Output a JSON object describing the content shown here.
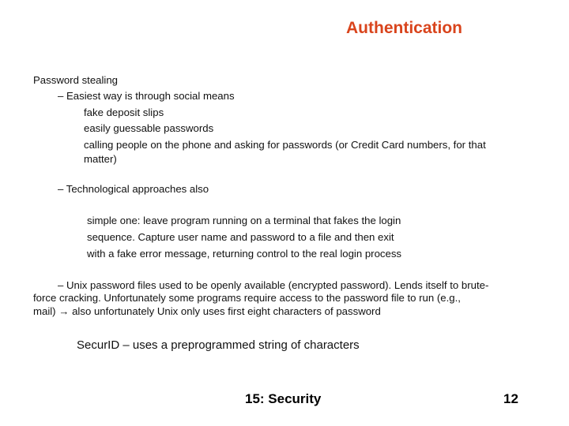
{
  "slide": {
    "title": "Authentication",
    "title_color": "#d9441c",
    "content": {
      "heading": "Password stealing",
      "social": {
        "bullet": "– Easiest way is through social means",
        "items": [
          "fake deposit slips",
          "easily guessable passwords",
          "calling people on the phone and asking for passwords (or Credit Card numbers, for that",
          "matter)"
        ]
      },
      "tech": {
        "bullet": "– Technological approaches also",
        "lines": [
          "simple one: leave program running on a terminal that fakes the login",
          "sequence. Capture user name and password to a file and then exit",
          "with a fake error message, returning control to the real login process"
        ]
      },
      "unix": {
        "lines": [
          "– Unix password files used to be openly available (encrypted password). Lends itself to brute-",
          "force cracking. Unfortunately some programs require access to the password file to run (e.g.,",
          "mail) → also unfortunately Unix only uses first eight characters of password"
        ]
      },
      "securid": "SecurID – uses a preprogrammed string of characters"
    },
    "footer": {
      "section": "15: Security",
      "page_number": "12"
    }
  }
}
